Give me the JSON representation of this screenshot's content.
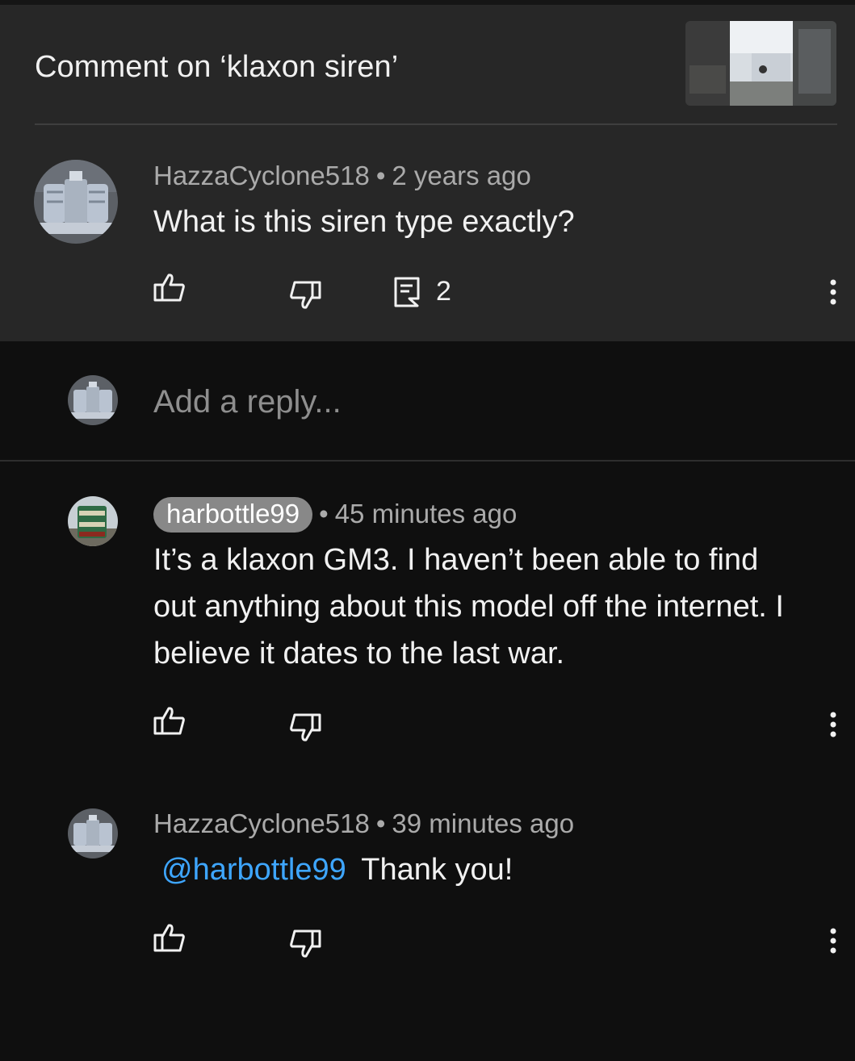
{
  "header": {
    "title": "Comment on ‘klaxon siren’",
    "thumbnail_icon": "video-thumbnail"
  },
  "parent_comment": {
    "author": "HazzaCyclone518",
    "separator": "•",
    "time": "2 years ago",
    "text": "What is this siren type exactly?",
    "reply_count": "2"
  },
  "reply_input": {
    "placeholder": "Add a reply..."
  },
  "replies": [
    {
      "author": "harbottle99",
      "separator": "•",
      "time": "45 minutes ago",
      "lines": [
        "It’s a klaxon GM3. I haven’t been able to find",
        "out anything about this model off the internet. I",
        "believe it dates to the last war."
      ]
    },
    {
      "author": "HazzaCyclone518",
      "separator": "•",
      "time": "39 minutes ago",
      "mention": "@harbottle99",
      "text": "Thank you!"
    }
  ],
  "colors": {
    "header_bg": "#272727",
    "page_bg": "#0f0f0f",
    "mention": "#3ea6ff",
    "meta_text": "#aaaaaa"
  }
}
